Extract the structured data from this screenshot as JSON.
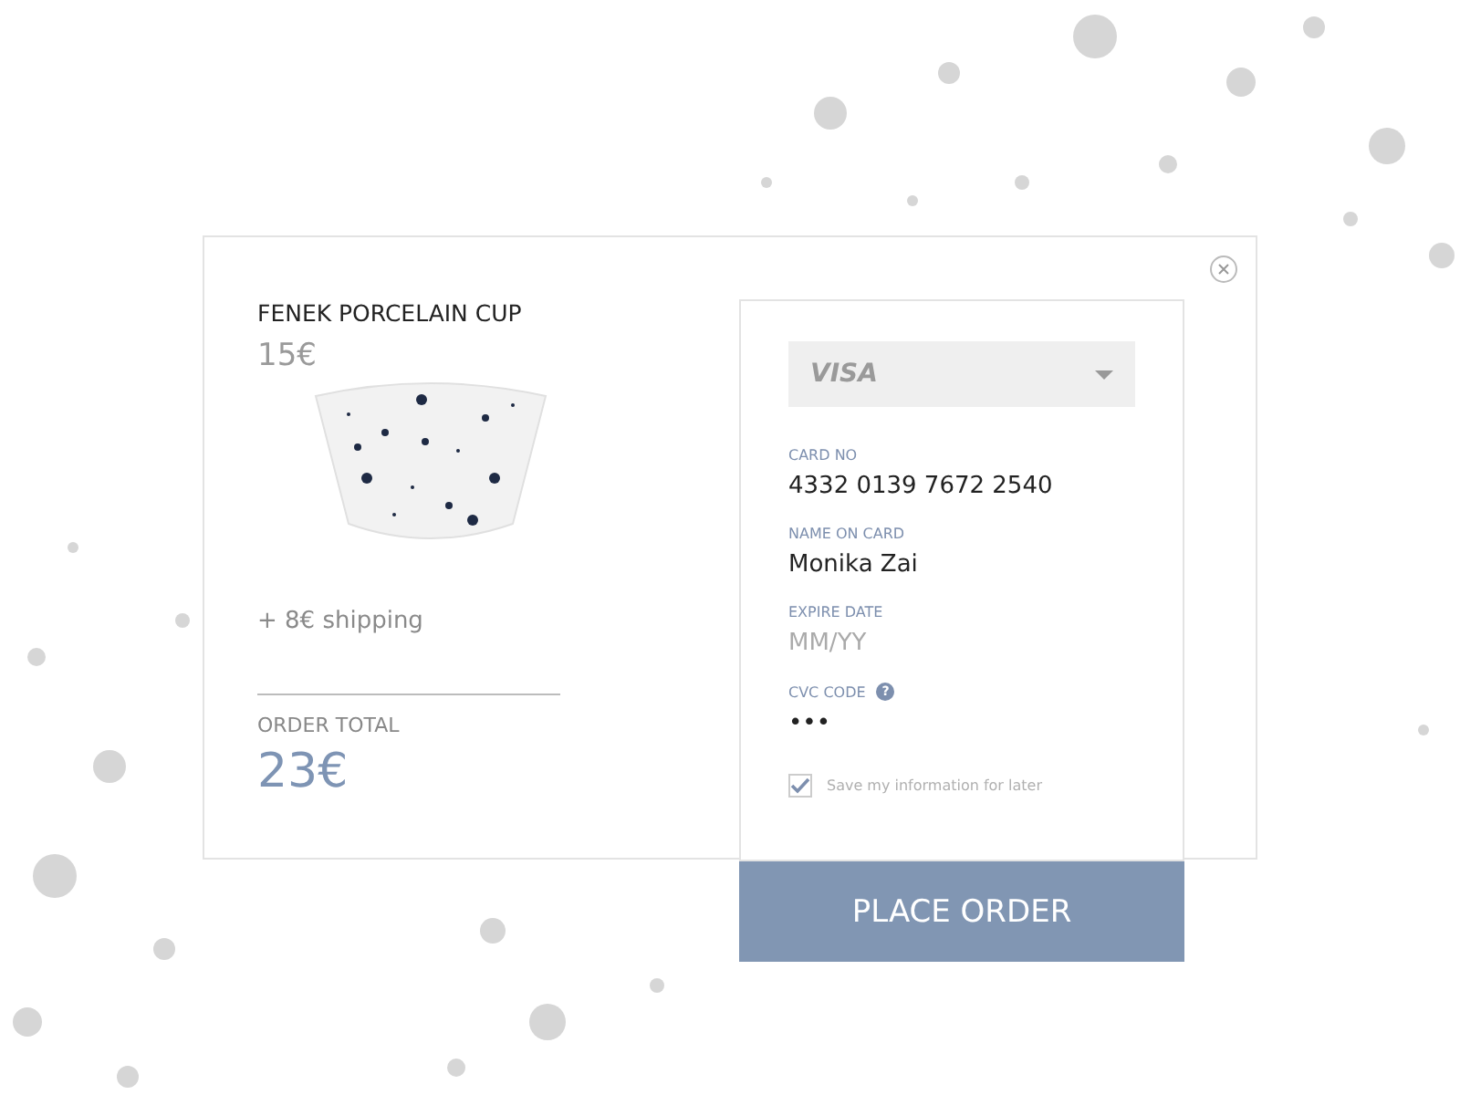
{
  "product": {
    "name": "FENEK PORCELAIN CUP",
    "price": "15€",
    "shipping": "+ 8€ shipping"
  },
  "total": {
    "label": "ORDER TOTAL",
    "value": "23€"
  },
  "payment": {
    "card_type": "VISA",
    "fields": [
      {
        "label": "CARD NO",
        "value": "4332 0139 7672 2540"
      },
      {
        "label": "NAME ON CARD",
        "value": "Monika Zai"
      },
      {
        "label": "EXPIRE DATE",
        "placeholder": "MM/YY"
      },
      {
        "label": "CVC CODE",
        "value": "•••",
        "help": "?"
      }
    ],
    "save": {
      "label": "Save my information for later",
      "checked": true
    }
  },
  "button": "PLACE ORDER"
}
